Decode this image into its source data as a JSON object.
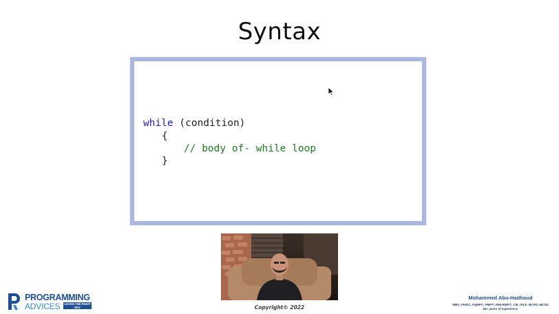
{
  "slide": {
    "title": "Syntax",
    "code": {
      "line1_keyword": "while",
      "line1_rest": " (condition)",
      "line2": "{",
      "line3_comment": "// body of- while loop",
      "line4": "}"
    }
  },
  "footer": {
    "copyright": "Copyright© 2022",
    "logo": {
      "line1": "PROGRAMMING",
      "line2": "ADVICES",
      "tagline": "LEARN THE RIGHT WAY"
    },
    "presenter": {
      "name": "Mohammed Abu-Hadhoud",
      "credentials": "MBA, PMOC, PgMP®, PMP®, PMI-RMP®, CM, ITILF, MCPD, MCSD",
      "experience": "26+ years of experience"
    }
  },
  "colors": {
    "keyword": "#1d1dc8",
    "comment": "#1f7a1f",
    "frame_border": "#a9b6df",
    "brand_blue": "#1d4f96"
  },
  "icons": {
    "pointer": "mouse-pointer-icon"
  }
}
